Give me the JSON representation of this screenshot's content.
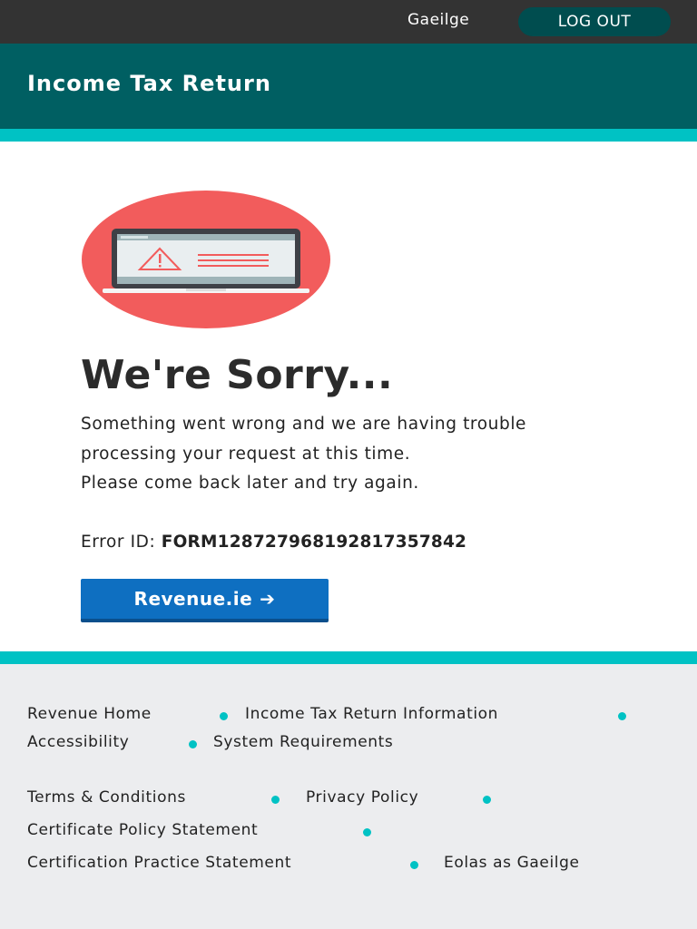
{
  "topbar": {
    "language_link": "Gaeilge",
    "logout_label": "LOG OUT"
  },
  "header": {
    "title": "Income Tax Return"
  },
  "error_page": {
    "heading": "We're Sorry...",
    "message_line1": "Something went wrong and we are having trouble processing your request at this time.",
    "message_line2": "Please come back later and try again.",
    "error_label": "Error ID:",
    "error_id": "FORM12872796819281735784​2",
    "button_label": "Revenue.ie",
    "button_arrow": "➔"
  },
  "footer": {
    "links": [
      "Revenue Home",
      "Income Tax Return Information",
      "Accessibility",
      "System Requirements",
      "Terms & Conditions",
      "Privacy Policy",
      "Certificate Policy Statement",
      "Certification Practice Statement",
      "Eolas as Gaeilge"
    ]
  },
  "colors": {
    "topbar": "#333333",
    "header": "#005f62",
    "accent": "#00c2c4",
    "button": "#0e6fc1",
    "illustration_circle": "#f25c5c"
  },
  "icons": {
    "illustration": "laptop-warning-icon"
  }
}
